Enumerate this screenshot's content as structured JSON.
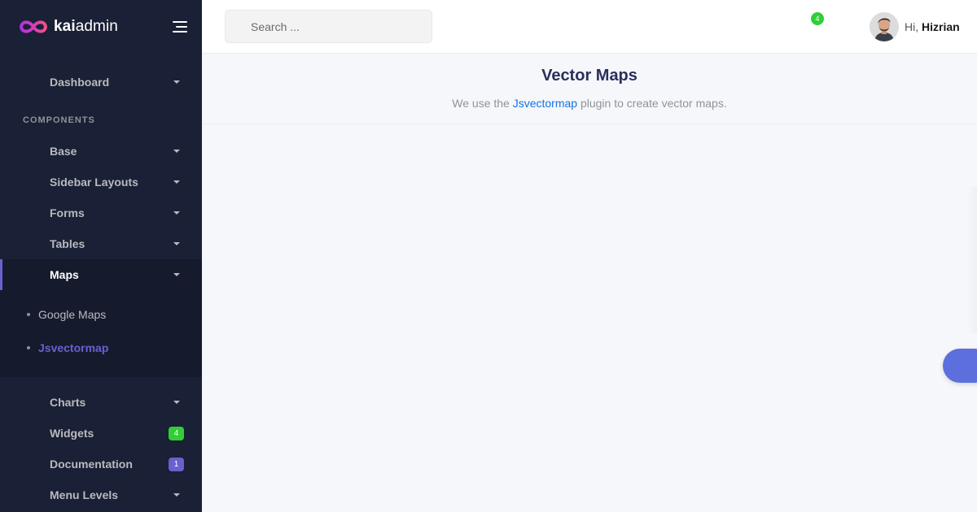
{
  "brand": {
    "name_bold": "kai",
    "name_light": "admin",
    "accent": "#6861ce"
  },
  "sidebar": {
    "dashboard": "Dashboard",
    "section_title": "COMPONENTS",
    "items": {
      "base": "Base",
      "sidebar_layouts": "Sidebar Layouts",
      "forms": "Forms",
      "tables": "Tables",
      "maps": "Maps",
      "charts": "Charts",
      "widgets": "Widgets",
      "documentation": "Documentation",
      "menu_levels": "Menu Levels"
    },
    "maps_submenu": {
      "google_maps": "Google Maps",
      "jsvectormap": "Jsvectormap"
    },
    "badges": {
      "widgets": "4",
      "documentation": "1"
    }
  },
  "header": {
    "search_placeholder": "Search ...",
    "notification_count": "4",
    "greeting": "Hi,",
    "user_name": "Hizrian"
  },
  "page": {
    "title": "Vector Maps",
    "description_prefix": "We use the ",
    "description_link": "Jsvectormap",
    "description_suffix": " plugin to create vector maps."
  },
  "colors": {
    "sidebar_bg": "#1a2035",
    "green_badge": "#31ce36",
    "purple_badge": "#6861ce",
    "link": "#1572e8"
  }
}
